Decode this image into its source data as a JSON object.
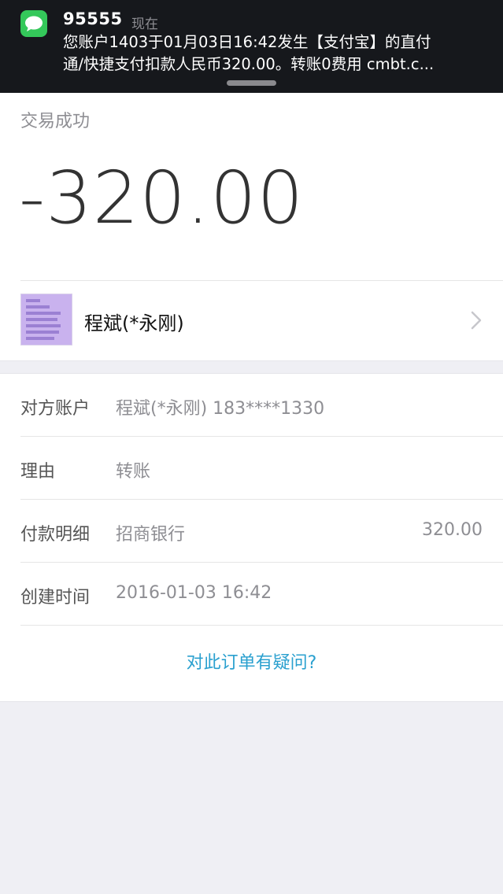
{
  "notification": {
    "sender": "95555",
    "time": "现在",
    "line1": "您账户1403于01月03日16:42发生【支付宝】的直付",
    "line2": "通/快捷支付扣款人民币320.00。转账0费用 cmbt.c...",
    "icon": "messages-icon",
    "icon_color": "#34c85a"
  },
  "transaction": {
    "status": "交易成功",
    "amount": "-320.00",
    "payee_name": "程斌(*永刚)"
  },
  "details": {
    "rows": [
      {
        "label": "对方账户",
        "value": "程斌(*永刚) 183****1330",
        "amount": ""
      },
      {
        "label": "理由",
        "value": "转账",
        "amount": ""
      },
      {
        "label": "付款明细",
        "value": "招商银行",
        "amount": "320.00"
      },
      {
        "label": "创建时间",
        "value": "2016-01-03 16:42",
        "amount": ""
      }
    ],
    "question_link": "对此订单有疑问?"
  },
  "colors": {
    "link": "#2aa0cf",
    "background": "#efeff4",
    "banner": "#16181c"
  }
}
